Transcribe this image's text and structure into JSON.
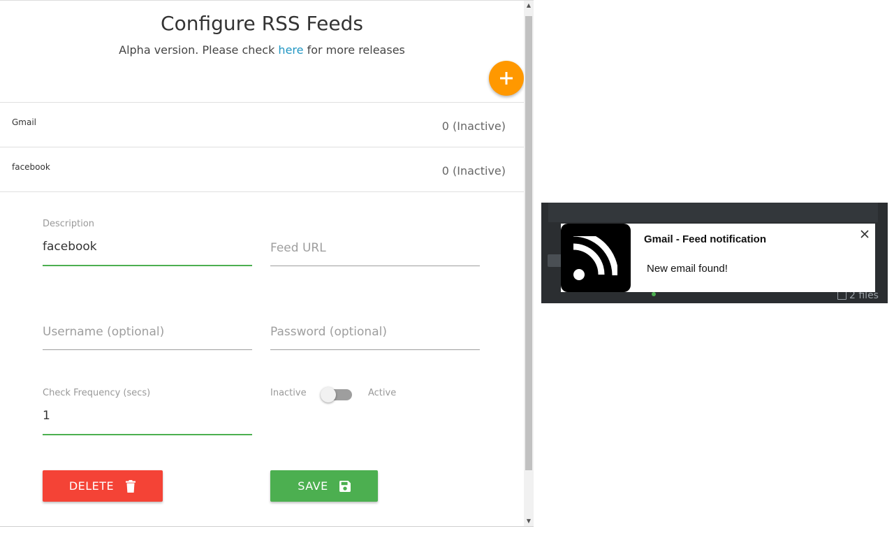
{
  "header": {
    "title": "Configure RSS Feeds",
    "subtitle_prefix": "Alpha version. Please check ",
    "subtitle_link": "here",
    "subtitle_suffix": " for more releases"
  },
  "add_button_icon": "plus-icon",
  "feeds": [
    {
      "name": "Gmail",
      "status": "0 (Inactive)"
    },
    {
      "name": "facebook",
      "status": "0 (Inactive)"
    }
  ],
  "form": {
    "description": {
      "label": "Description",
      "value": "facebook"
    },
    "feed_url": {
      "placeholder": "Feed URL",
      "value": ""
    },
    "username": {
      "placeholder": "Username (optional)",
      "value": ""
    },
    "password": {
      "placeholder": "Password (optional)",
      "value": ""
    },
    "check_frequency": {
      "label": "Check Frequency (secs)",
      "value": "1"
    },
    "toggle": {
      "off_label": "Inactive",
      "on_label": "Active",
      "state": false
    },
    "delete_label": "DELETE",
    "save_label": "SAVE"
  },
  "notification": {
    "title": "Gmail - Feed notification",
    "body": "New email found!",
    "icon": "rss-icon",
    "background_partial_text": "2 files"
  },
  "colors": {
    "accent_orange": "#ff9800",
    "delete_red": "#f44336",
    "save_green": "#4caf50",
    "link_blue": "#2196c3"
  }
}
